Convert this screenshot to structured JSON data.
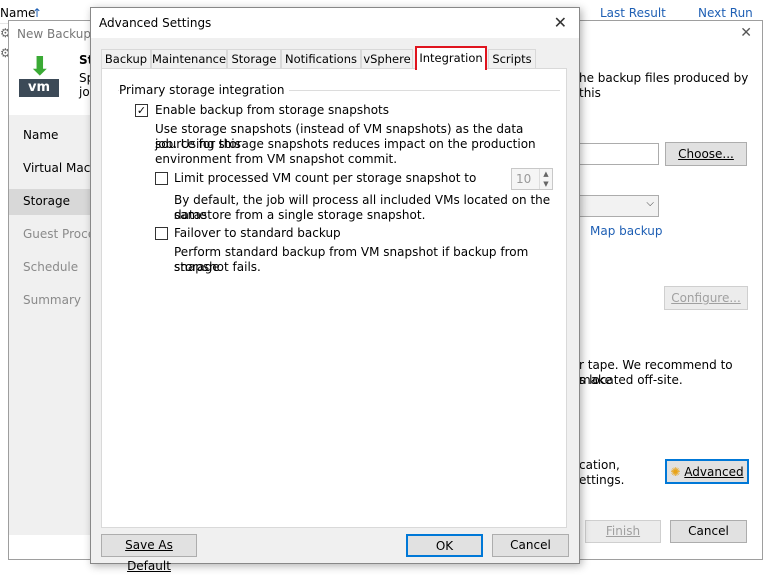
{
  "background": {
    "col_name": "Name",
    "col_last_result": "Last Result",
    "col_next_run": "Next Run"
  },
  "wizard": {
    "title": "New Backup J",
    "header_title": "St",
    "header_desc_line1": "Sp",
    "header_desc_line2": "jo",
    "header_desc_right": "he backup files produced by this",
    "vm_badge": "vm",
    "nav": [
      "Name",
      "Virtual Mach",
      "Storage",
      "Guest Proces",
      "Schedule",
      "Summary"
    ],
    "choose_label": "Choose...",
    "map_backup_label": "Map backup",
    "configure_label": "Configure...",
    "tape_text_line1": "r tape. We recommend to make",
    "tape_text_line2": "s located off-site.",
    "advanced_text_line1": "cation,",
    "advanced_text_line2": "ettings.",
    "advanced_label": "Advanced",
    "finish_label": "Finish",
    "cancel_label": "Cancel"
  },
  "dialog": {
    "title": "Advanced Settings",
    "tabs": [
      "Backup",
      "Maintenance",
      "Storage",
      "Notifications",
      "vSphere",
      "Integration",
      "Scripts"
    ],
    "active_tab": "Integration",
    "group_label": "Primary storage integration",
    "enable_snapshots_label": "Enable backup from storage snapshots",
    "enable_snapshots_checked": true,
    "enable_desc_1": "Use storage snapshots (instead of VM snapshots) as the data source for this",
    "enable_desc_2": "job. Using storage snapshots reduces impact on the production",
    "enable_desc_3": "environment from VM snapshot commit.",
    "limit_label": "Limit processed VM count per storage snapshot to",
    "limit_checked": false,
    "limit_value": "10",
    "limit_desc_1": "By default, the job will process all included VMs located on the same",
    "limit_desc_2": "datastore from a single storage snapshot.",
    "failover_label": "Failover to standard backup",
    "failover_checked": false,
    "failover_desc_1": "Perform standard backup from VM snapshot if backup from storage",
    "failover_desc_2": "snapshot fails.",
    "save_default_label": "Save As Default",
    "ok_label": "OK",
    "cancel_label": "Cancel"
  },
  "colors": {
    "active_tab_border": "#e0141e",
    "link": "#1e5fb4",
    "veeam_green": "#3aaa35"
  }
}
